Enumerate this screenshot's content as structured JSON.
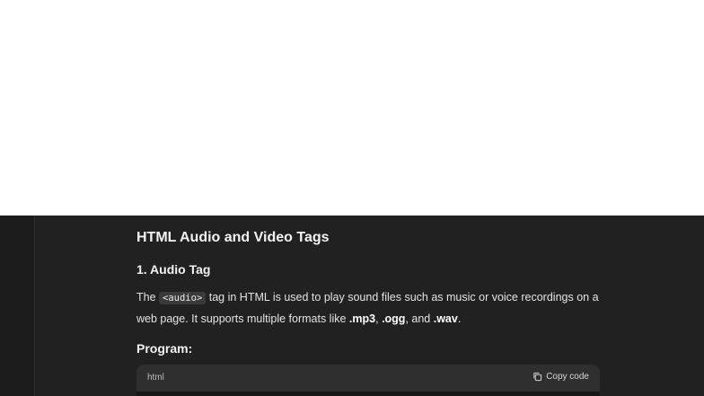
{
  "article": {
    "title": "HTML Audio and Video Tags",
    "section_heading": "1. Audio Tag",
    "paragraph": {
      "text_before_code": "The ",
      "inline_code": "<audio>",
      "text_after_code": " tag in HTML is used to play sound files such as music or voice recordings on a web page. It supports multiple formats like ",
      "format_mp3": ".mp3",
      "sep1": ", ",
      "format_ogg": ".ogg",
      "sep2": ", and ",
      "format_wav": ".wav",
      "end": "."
    },
    "program_label": "Program:"
  },
  "code_block": {
    "language": "html",
    "copy_label": "Copy code",
    "copy_icon": "copy-icon"
  },
  "colors": {
    "chat_background": "#212121",
    "code_header": "#2f2f2f",
    "text": "#ececec"
  }
}
